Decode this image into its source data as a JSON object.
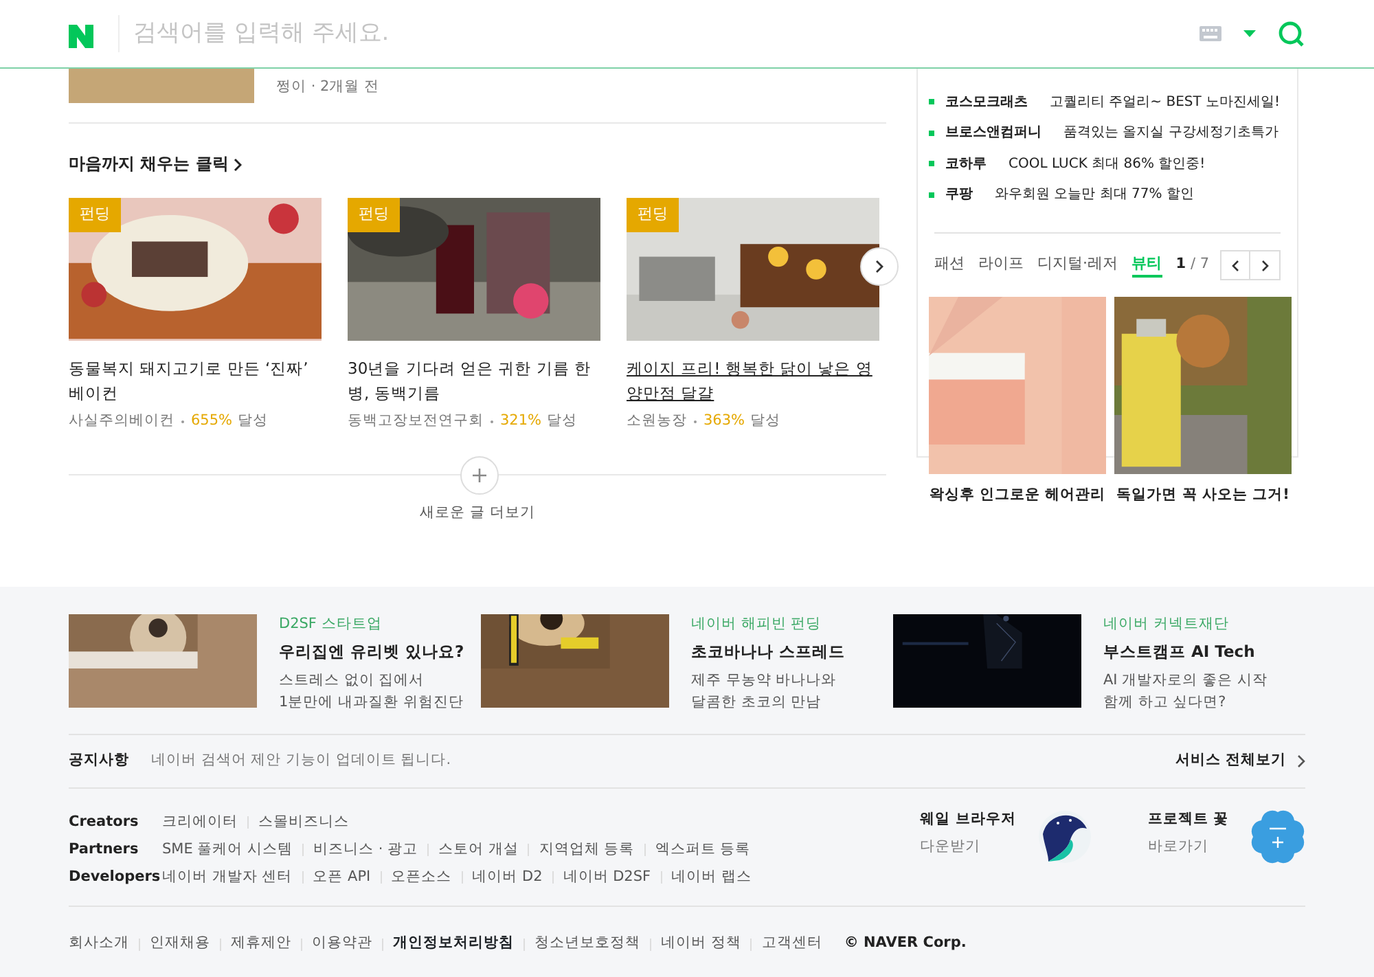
{
  "header": {
    "search_placeholder": "검색어를 입력해 주세요."
  },
  "top_post": {
    "meta": "쩡이 · 2개월 전"
  },
  "funding": {
    "title": "마음까지 채우는 클릭",
    "cards": [
      {
        "badge": "펀딩",
        "title": "동물복지 돼지고기로 만든 ‘진짜’ 베이컨",
        "author": "사실주의베이컨",
        "rate": "655%",
        "suffix": "달성",
        "hovered": false
      },
      {
        "badge": "펀딩",
        "title": "30년을 기다려 얻은 귀한 기름 한 병, 동백기름",
        "author": "동백고장보전연구회",
        "rate": "321%",
        "suffix": "달성",
        "hovered": false
      },
      {
        "badge": "펀딩",
        "title": "케이지 프리! 행복한 닭이 낳은 영양만점 달걀",
        "author": "소원농장",
        "rate": "363%",
        "suffix": "달성",
        "hovered": true
      }
    ],
    "more": "새로운 글 더보기"
  },
  "shopping": {
    "items": [
      {
        "brand": "코스모크래츠",
        "text": "고퀄리티 주얼리~ BEST 노마진세일!"
      },
      {
        "brand": "브로스앤컴퍼니",
        "text": "품격있는 올지실 구강세정기초특가"
      },
      {
        "brand": "코하루",
        "text": "COOL LUCK 최대 86% 할인중!"
      },
      {
        "brand": "쿠팡",
        "text": "와우회원 오늘만 최대 77% 할인"
      }
    ],
    "tabs": [
      {
        "label": "패션",
        "selected": false
      },
      {
        "label": "라이프",
        "selected": false
      },
      {
        "label": "디지털·레저",
        "selected": false
      },
      {
        "label": "뷰티",
        "selected": true
      }
    ],
    "page": "1",
    "total": "/ 7",
    "products": [
      {
        "caption": "왁싱후 인그로운 헤어관리"
      },
      {
        "caption": "독일가면 꼭 사오는 그거!"
      }
    ]
  },
  "promos": [
    {
      "category": "D2SF 스타트업",
      "title": "우리집엔 유리벳 있나요?",
      "lines": [
        "스트레스 없이 집에서",
        "1분만에 내과질환 위험진단"
      ]
    },
    {
      "category": "네이버 해피빈 펀딩",
      "title": "초코바나나 스프레드",
      "lines": [
        "제주 무농약 바나나와",
        "달콤한 초코의 만남"
      ]
    },
    {
      "category": "네이버 커넥트재단",
      "title": "부스트캠프 AI Tech",
      "lines": [
        "AI 개발자로의 좋은 시작",
        "함께 하고 싶다면?"
      ]
    }
  ],
  "notice": {
    "label": "공지사항",
    "text": "네이버 검색어 제안 기능이 업데이트 됩니다.",
    "all_services": "서비스 전체보기"
  },
  "partner_rows": [
    {
      "label": "Creators",
      "links": [
        "크리에이터",
        "스몰비즈니스"
      ]
    },
    {
      "label": "Partners",
      "links": [
        "SME 풀케어 시스템",
        "비즈니스 · 광고",
        "스토어 개설",
        "지역업체 등록",
        "엑스퍼트 등록"
      ]
    },
    {
      "label": "Developers",
      "links": [
        "네이버 개발자 센터",
        "오픈 API",
        "오픈소스",
        "네이버 D2",
        "네이버 D2SF",
        "네이버 랩스"
      ]
    }
  ],
  "apps": [
    {
      "name": "웨일 브라우저",
      "action": "다운받기",
      "kind": "whale"
    },
    {
      "name": "프로젝트 꽃",
      "action": "바로가기",
      "kind": "flower"
    }
  ],
  "bottom_links": [
    {
      "label": "회사소개",
      "bold": false
    },
    {
      "label": "인재채용",
      "bold": false
    },
    {
      "label": "제휴제안",
      "bold": false
    },
    {
      "label": "이용약관",
      "bold": false
    },
    {
      "label": "개인정보처리방침",
      "bold": true
    },
    {
      "label": "청소년보호정책",
      "bold": false
    },
    {
      "label": "네이버 정책",
      "bold": false
    },
    {
      "label": "고객센터",
      "bold": false
    }
  ],
  "copyright": "© NAVER Corp."
}
